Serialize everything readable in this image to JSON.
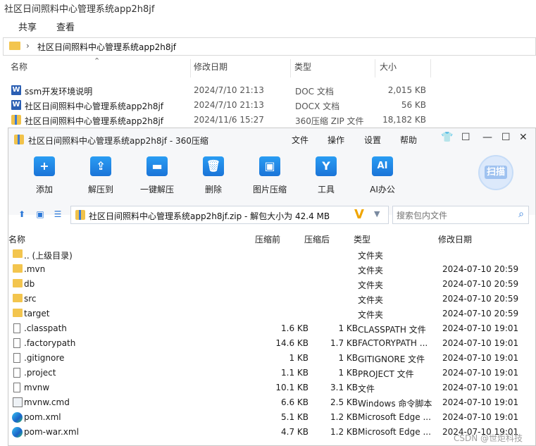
{
  "explorer": {
    "title": "社区日间照料中心管理系统app2h8jf",
    "ribbon": {
      "share": "共享",
      "view": "查看"
    },
    "address": {
      "chevron": "›",
      "path": "社区日间照料中心管理系统app2h8jf"
    },
    "columns": {
      "name": "名称",
      "modified": "修改日期",
      "type": "类型",
      "size": "大小"
    },
    "files": [
      {
        "icon": "word-doc-icon",
        "name": "ssm开发环境说明",
        "modified": "2024/7/10 21:13",
        "type": "DOC 文档",
        "size": "2,015 KB"
      },
      {
        "icon": "word-docx-icon",
        "name": "社区日间照料中心管理系统app2h8jf",
        "modified": "2024/7/10 21:13",
        "type": "DOCX 文档",
        "size": "56 KB"
      },
      {
        "icon": "zip-icon",
        "name": "社区日间照料中心管理系统app2h8jf",
        "modified": "2024/11/6 15:27",
        "type": "360压缩 ZIP 文件",
        "size": "18,182 KB"
      }
    ]
  },
  "archiver": {
    "title": "社区日间照料中心管理系统app2h8jf - 360压缩",
    "menu": {
      "file": "文件",
      "ops": "操作",
      "settings": "设置",
      "help": "帮助"
    },
    "window_controls": {
      "shirt": "👕",
      "feedback": "☐",
      "minimize": "—",
      "maximize": "☐",
      "close": "✕"
    },
    "toolbar": [
      {
        "label": "添加",
        "glyph": "+"
      },
      {
        "label": "解压到",
        "glyph": "⇪"
      },
      {
        "label": "一键解压",
        "glyph": "▬"
      },
      {
        "label": "删除",
        "glyph": "🗑"
      },
      {
        "label": "图片压缩",
        "glyph": "▣"
      },
      {
        "label": "工具",
        "glyph": "Y"
      },
      {
        "label": "AI办公",
        "glyph": "AI"
      }
    ],
    "scan_label": "扫描",
    "path": "社区日间照料中心管理系统app2h8jf.zip - 解包大小为 42.4 MB",
    "search_placeholder": "搜索包内文件",
    "columns": {
      "name": "名称",
      "before": "压缩前",
      "after": "压缩后",
      "type": "类型",
      "modified": "修改日期"
    },
    "rows": [
      {
        "icon": "folder-icon",
        "name": ".. (上级目录)",
        "before": "",
        "after": "",
        "type": "文件夹",
        "modified": ""
      },
      {
        "icon": "folder-icon",
        "name": ".mvn",
        "before": "",
        "after": "",
        "type": "文件夹",
        "modified": "2024-07-10 20:59"
      },
      {
        "icon": "folder-icon",
        "name": "db",
        "before": "",
        "after": "",
        "type": "文件夹",
        "modified": "2024-07-10 20:59"
      },
      {
        "icon": "folder-icon",
        "name": "src",
        "before": "",
        "after": "",
        "type": "文件夹",
        "modified": "2024-07-10 20:59"
      },
      {
        "icon": "folder-icon",
        "name": "target",
        "before": "",
        "after": "",
        "type": "文件夹",
        "modified": "2024-07-10 20:59"
      },
      {
        "icon": "file-icon",
        "name": ".classpath",
        "before": "1.6 KB",
        "after": "1 KB",
        "type": "CLASSPATH 文件",
        "modified": "2024-07-10 19:01"
      },
      {
        "icon": "file-icon",
        "name": ".factorypath",
        "before": "14.6 KB",
        "after": "1.7 KB",
        "type": "FACTORYPATH ...",
        "modified": "2024-07-10 19:01"
      },
      {
        "icon": "file-icon",
        "name": ".gitignore",
        "before": "1 KB",
        "after": "1 KB",
        "type": "GITIGNORE 文件",
        "modified": "2024-07-10 19:01"
      },
      {
        "icon": "file-icon",
        "name": ".project",
        "before": "1.1 KB",
        "after": "1 KB",
        "type": "PROJECT 文件",
        "modified": "2024-07-10 19:01"
      },
      {
        "icon": "file-icon",
        "name": "mvnw",
        "before": "10.1 KB",
        "after": "3.1 KB",
        "type": "文件",
        "modified": "2024-07-10 19:01"
      },
      {
        "icon": "cmd-icon",
        "name": "mvnw.cmd",
        "before": "6.6 KB",
        "after": "2.5 KB",
        "type": "Windows 命令脚本",
        "modified": "2024-07-10 19:01"
      },
      {
        "icon": "edge-icon",
        "name": "pom.xml",
        "before": "5.1 KB",
        "after": "1.2 KB",
        "type": "Microsoft Edge ...",
        "modified": "2024-07-10 19:01"
      },
      {
        "icon": "edge-icon",
        "name": "pom-war.xml",
        "before": "4.7 KB",
        "after": "1.2 KB",
        "type": "Microsoft Edge ...",
        "modified": "2024-07-10 19:01"
      }
    ]
  },
  "watermark": "CSDN @世炬科技"
}
